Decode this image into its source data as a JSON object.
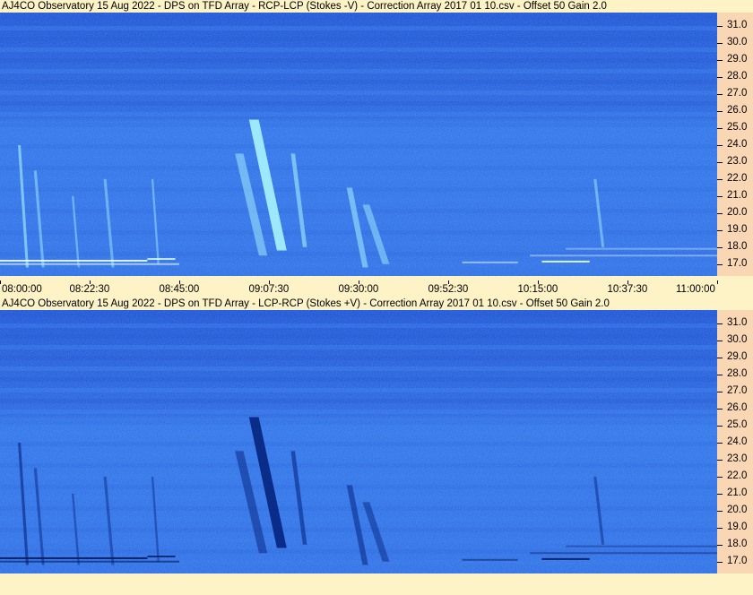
{
  "panels": [
    {
      "title": "AJ4CO Observatory 15 Aug 2022  -  DPS on TFD Array  -  RCP-LCP (Stokes -V)  -  Correction Array 2017 01 10.csv  -  Offset 50  Gain 2.0",
      "polarity": "positive"
    },
    {
      "title": "AJ4CO Observatory 15 Aug 2022  -  DPS on TFD Array  -  LCP-RCP (Stokes +V)  -  Correction Array 2017 01 10.csv  -  Offset 50  Gain 2.0",
      "polarity": "negative"
    }
  ],
  "chart_data": {
    "type": "heatmap",
    "x_tick_labels": [
      "08:00:00",
      "08:22:30",
      "08:45:00",
      "09:07:30",
      "09:30:00",
      "09:52:30",
      "10:15:00",
      "10:37:30",
      "11:00:00"
    ],
    "y_tick_labels": [
      "31.0",
      "30.0",
      "29.0",
      "28.0",
      "27.0",
      "26.0",
      "25.0",
      "24.0",
      "23.0",
      "22.0",
      "21.0",
      "20.0",
      "19.0",
      "18.0",
      "17.0"
    ],
    "y_ticks_mhz": [
      31,
      30,
      29,
      28,
      27,
      26,
      25,
      24,
      23,
      22,
      21,
      20,
      19,
      18,
      17
    ],
    "ylim_mhz": [
      16.3,
      31.8
    ],
    "xlim_time": [
      "08:00:00",
      "11:00:00"
    ],
    "colors": {
      "background": "#2f6fe6",
      "bright_emission": "#9ff0ff",
      "dark_emission": "#0a2a8a",
      "axis_panel": "#f9d6b4",
      "page": "#fdf3c6"
    },
    "bursts": [
      {
        "start": "08:04:30",
        "end": "08:06:30",
        "f_high_mhz": 24.0,
        "f_low_mhz": 16.8,
        "intensity": 0.55
      },
      {
        "start": "08:08:30",
        "end": "08:10:30",
        "f_high_mhz": 22.5,
        "f_low_mhz": 16.8,
        "intensity": 0.35
      },
      {
        "start": "08:18:00",
        "end": "08:19:30",
        "f_high_mhz": 21.0,
        "f_low_mhz": 16.8,
        "intensity": 0.3
      },
      {
        "start": "08:26:00",
        "end": "08:28:00",
        "f_high_mhz": 22.0,
        "f_low_mhz": 16.8,
        "intensity": 0.3
      },
      {
        "start": "08:38:00",
        "end": "08:39:30",
        "f_high_mhz": 22.0,
        "f_low_mhz": 17.0,
        "intensity": 0.3
      },
      {
        "start": "08:59:00",
        "end": "09:05:00",
        "f_high_mhz": 23.5,
        "f_low_mhz": 17.5,
        "intensity": 0.4
      },
      {
        "start": "09:02:30",
        "end": "09:09:30",
        "f_high_mhz": 25.5,
        "f_low_mhz": 17.8,
        "intensity": 1.0
      },
      {
        "start": "09:13:00",
        "end": "09:16:00",
        "f_high_mhz": 23.5,
        "f_low_mhz": 18.0,
        "intensity": 0.5
      },
      {
        "start": "09:27:00",
        "end": "09:31:00",
        "f_high_mhz": 21.5,
        "f_low_mhz": 16.8,
        "intensity": 0.45
      },
      {
        "start": "09:31:00",
        "end": "09:36:00",
        "f_high_mhz": 20.5,
        "f_low_mhz": 17.0,
        "intensity": 0.35
      },
      {
        "start": "10:29:00",
        "end": "10:31:00",
        "f_high_mhz": 22.0,
        "f_low_mhz": 18.0,
        "intensity": 0.35
      }
    ],
    "interference_bands": [
      {
        "start": "08:00:00",
        "end": "08:37:00",
        "mhz": 17.2,
        "intensity": 0.9
      },
      {
        "start": "08:00:00",
        "end": "08:45:00",
        "mhz": 17.0,
        "intensity": 0.6
      },
      {
        "start": "08:37:00",
        "end": "08:44:00",
        "mhz": 17.3,
        "intensity": 0.8
      },
      {
        "start": "10:16:00",
        "end": "10:28:00",
        "mhz": 17.15,
        "intensity": 0.9
      },
      {
        "start": "10:13:00",
        "end": "11:00:00",
        "mhz": 17.5,
        "intensity": 0.4
      },
      {
        "start": "10:22:00",
        "end": "11:00:00",
        "mhz": 17.9,
        "intensity": 0.35
      },
      {
        "start": "09:56:00",
        "end": "10:10:00",
        "mhz": 17.1,
        "intensity": 0.5
      }
    ]
  }
}
